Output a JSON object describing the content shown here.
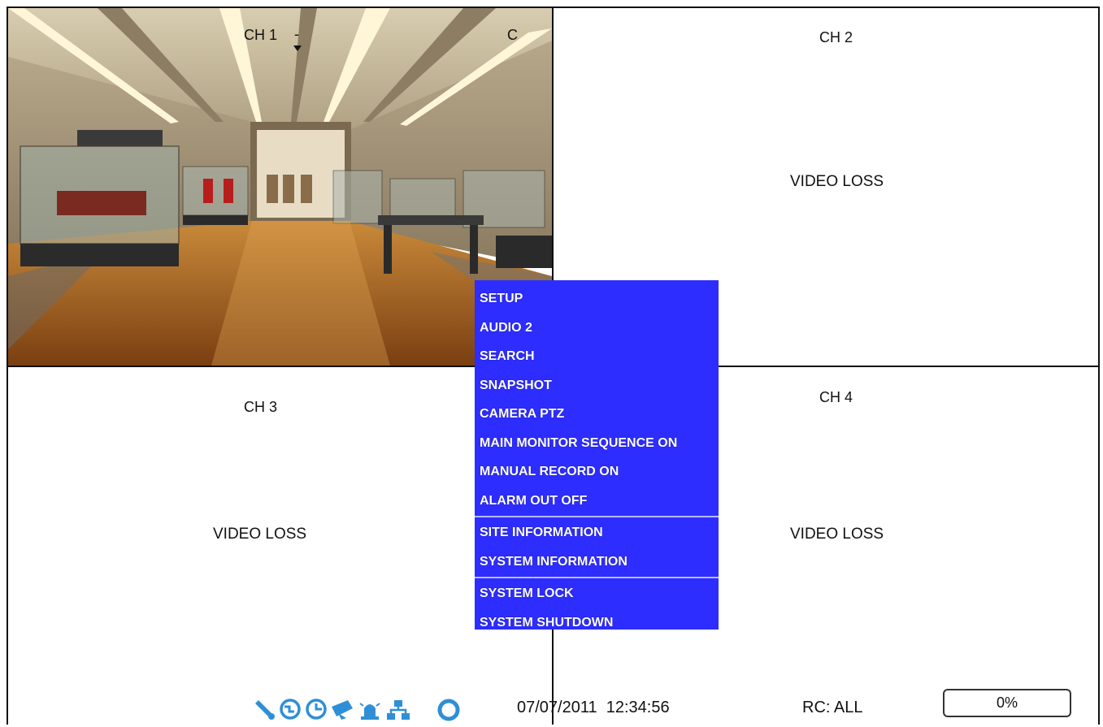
{
  "channels": {
    "ch1": {
      "label": "CH 1",
      "marker_dash": "-",
      "marker_c": "C"
    },
    "ch2": {
      "label": "CH 2",
      "status": "VIDEO LOSS"
    },
    "ch3": {
      "label": "CH 3",
      "status": "VIDEO LOSS"
    },
    "ch4": {
      "label": "CH 4",
      "status": "VIDEO LOSS"
    }
  },
  "context_menu": {
    "background_color": "#2d2dff",
    "group1": [
      "SETUP",
      "AUDIO 2",
      "SEARCH",
      "SNAPSHOT",
      "CAMERA PTZ",
      "MAIN MONITOR SEQUENCE ON",
      "MANUAL RECORD ON",
      "ALARM OUT OFF"
    ],
    "group2": [
      "SITE INFORMATION",
      "SYSTEM INFORMATION"
    ],
    "group3": [
      "SYSTEM LOCK",
      "SYSTEM SHUTDOWN"
    ]
  },
  "status_bar": {
    "icons": [
      "wrench-icon",
      "network-globe-icon",
      "clock-icon",
      "record-arrow-icon",
      "alarm-siren-icon",
      "network-tree-icon",
      "refresh-ring-icon"
    ],
    "icon_color": "#2f8fd6",
    "datetime": "07/07/2011  12:34:56",
    "remote_control": "RC: ALL",
    "hdd_usage": "0%"
  }
}
